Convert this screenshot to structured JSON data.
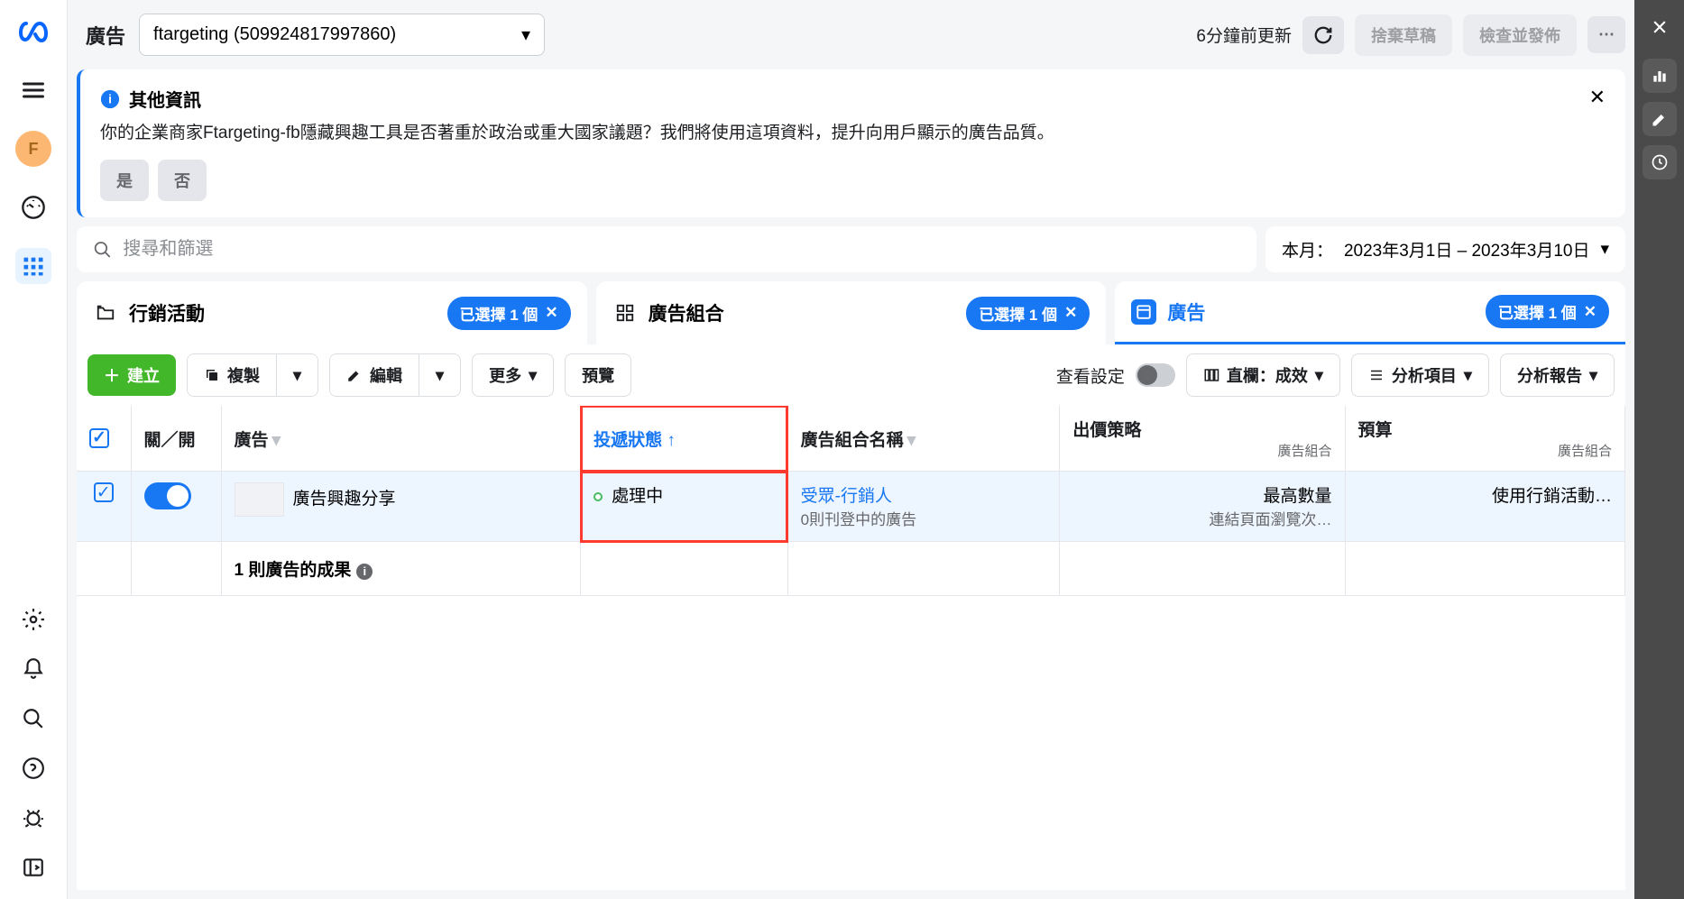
{
  "leftRail": {
    "avatarLetter": "F"
  },
  "topBar": {
    "label": "廣告",
    "accountName": "ftargeting (509924817997860)",
    "updatedText": "6分鐘前更新",
    "discardDraft": "捨棄草稿",
    "reviewPublish": "檢查並發佈"
  },
  "banner": {
    "title": "其他資訊",
    "body": "你的企業商家Ftargeting-fb隱藏興趣工具是否著重於政治或重大國家議題？我們將使用這項資料，提升向用戶顯示的廣告品質。",
    "yes": "是",
    "no": "否"
  },
  "search": {
    "placeholder": "搜尋和篩選"
  },
  "dateSelector": {
    "prefix": "本月：",
    "range": "2023年3月1日 – 2023年3月10日"
  },
  "tabs": {
    "campaigns": "行銷活動",
    "adSets": "廣告組合",
    "ads": "廣告",
    "selectedBadge": "已選擇 1 個"
  },
  "toolbar": {
    "create": "建立",
    "duplicate": "複製",
    "edit": "編輯",
    "more": "更多",
    "preview": "預覽",
    "viewSettings": "查看設定",
    "columns": "直欄：成效",
    "breakdown": "分析項目",
    "reports": "分析報告"
  },
  "columns": {
    "onOff": "關／開",
    "ad": "廣告",
    "delivery": "投遞狀態",
    "adSetName": "廣告組合名稱",
    "bidStrategy": "出價策略",
    "budget": "預算",
    "subAdSet": "廣告組合"
  },
  "row": {
    "adName": "廣告興趣分享",
    "deliveryStatus": "處理中",
    "adSetLink": "受眾-行銷人",
    "adSetSub": "0則刊登中的廣告",
    "bid": "最高數量",
    "bidSub": "連結頁面瀏覽次…",
    "budget": "使用行銷活動…"
  },
  "resultsRow": {
    "label": "1 則廣告的成果"
  }
}
